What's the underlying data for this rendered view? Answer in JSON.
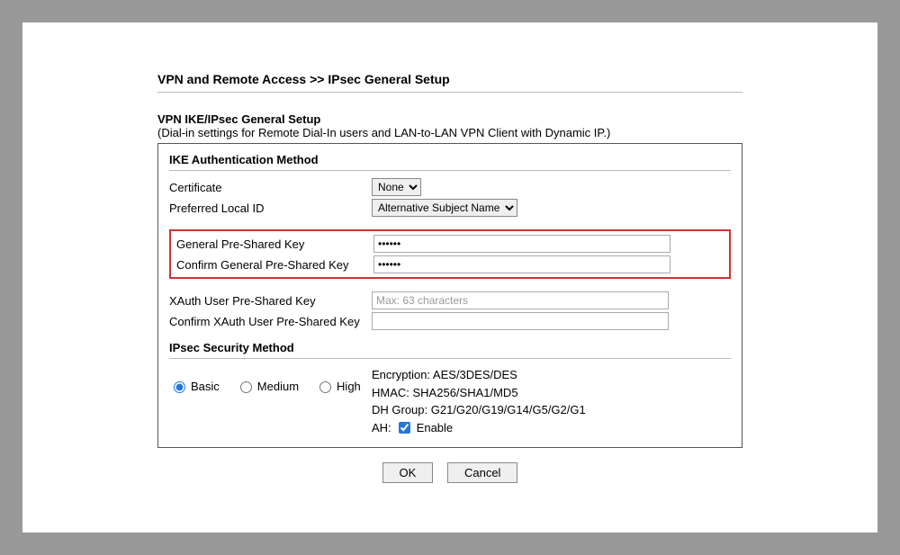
{
  "breadcrumb": "VPN and Remote Access >> IPsec General Setup",
  "section_title": "VPN IKE/IPsec General Setup",
  "section_sub": "(Dial-in settings for Remote Dial-In users and LAN-to-LAN VPN Client with Dynamic IP.)",
  "ike_heading": "IKE Authentication Method",
  "cert_label": "Certificate",
  "cert_value": "None",
  "pref_local_label": "Preferred Local ID",
  "pref_local_value": "Alternative Subject Name",
  "psk_label": "General Pre-Shared Key",
  "psk_value": "••••••",
  "psk_confirm_label": "Confirm General Pre-Shared Key",
  "psk_confirm_value": "••••••",
  "xauth_label": "XAuth User Pre-Shared Key",
  "xauth_placeholder": "Max: 63 characters",
  "xauth_confirm_label": "Confirm XAuth User Pre-Shared Key",
  "ipsec_heading": "IPsec Security Method",
  "radios": {
    "basic": "Basic",
    "medium": "Medium",
    "high": "High"
  },
  "details": {
    "encryption": "Encryption: AES/3DES/DES",
    "hmac": "HMAC: SHA256/SHA1/MD5",
    "dhgroup": "DH Group: G21/G20/G19/G14/G5/G2/G1",
    "ah_label": "AH:",
    "enable": "Enable"
  },
  "buttons": {
    "ok": "OK",
    "cancel": "Cancel"
  }
}
